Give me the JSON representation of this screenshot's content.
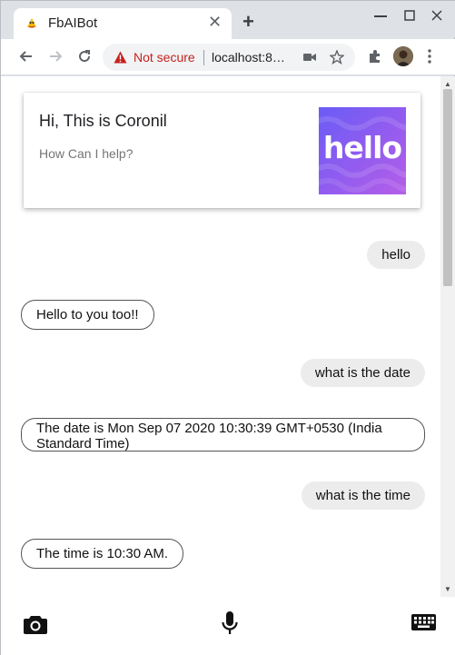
{
  "browser": {
    "tab_title": "FbAIBot",
    "tab_close": "✕",
    "new_tab": "+",
    "security_label": "Not secure",
    "url_text": "localhost:8…",
    "window_controls": [
      "minimize-icon",
      "maximize-icon",
      "close-icon"
    ]
  },
  "card": {
    "title": "Hi, This is Coronil",
    "subtitle": "How Can I help?",
    "image_text": "hello"
  },
  "messages": [
    {
      "role": "user",
      "text": "hello"
    },
    {
      "role": "bot",
      "text": "Hello to you too!!"
    },
    {
      "role": "user",
      "text": "what is the date"
    },
    {
      "role": "bot",
      "text": "The date is Mon Sep 07 2020 10:30:39 GMT+0530 (India Standard Time)"
    },
    {
      "role": "user",
      "text": "what is the time"
    },
    {
      "role": "bot",
      "text": "The time is 10:30 AM."
    }
  ],
  "bottom_bar": {
    "icons": [
      "camera-icon",
      "microphone-icon",
      "keyboard-icon"
    ]
  },
  "colors": {
    "user_bubble": "#ececec",
    "bot_border": "#555555",
    "warning_red": "#c5221f"
  }
}
